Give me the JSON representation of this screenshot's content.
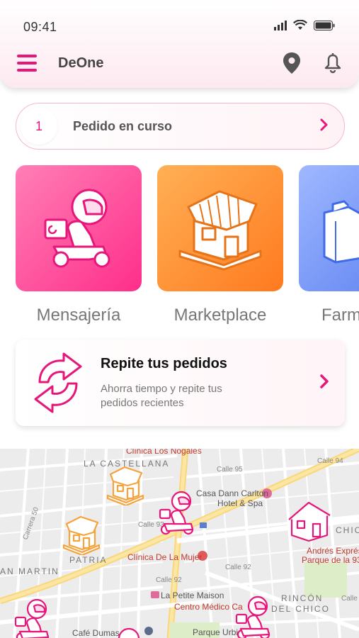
{
  "status_bar": {
    "time": "09:41"
  },
  "app": {
    "title": "DeOne"
  },
  "order": {
    "count": "1",
    "label": "Pedido en curso"
  },
  "categories": [
    {
      "label": "Mensajería",
      "color": "#ff3d8f"
    },
    {
      "label": "Marketplace",
      "color": "#ff8a2a"
    },
    {
      "label": "Farm",
      "color": "#6a8cf5"
    }
  ],
  "repeat": {
    "title": "Repite tus pedidos",
    "subtitle": "Ahorra tiempo y repite tus pedidos recientes"
  },
  "map": {
    "labels": {
      "castellana": "LA CASTELLANA",
      "patria": "PATRIA",
      "san_martin": "AN MARTIN",
      "rincon": "RINCÓN",
      "del_chico": "DEL CHICO",
      "chic": "CHIC",
      "clinica_nogales": "Clínica Los Nogales",
      "casa_dann": "Casa Dann Carlton",
      "hotel_spa": "Hotel & Spa",
      "clinica_mujer": "Clínica De La Mujer",
      "petite_maison": "La Petite Maison",
      "centro_medico": "Centro Médico Ca",
      "andres_1": "Andrés Exprés",
      "andres_2": "Parque de la 93",
      "parque_urbi": "Parque Urbi",
      "cafe_dumas": "Café Dumas",
      "calle_93": "Calle 93",
      "calle_92": "Calle 92",
      "calle_92b": "Calle 92",
      "calle_93b": "Calle 93",
      "calle_95": "Calle 95",
      "calle_94": "Calle 94",
      "carrera_50": "Carrera 50"
    }
  },
  "colors": {
    "accent": "#e6177a",
    "map_marker_pink": "#e6177a",
    "map_marker_orange": "#f5a33a"
  }
}
